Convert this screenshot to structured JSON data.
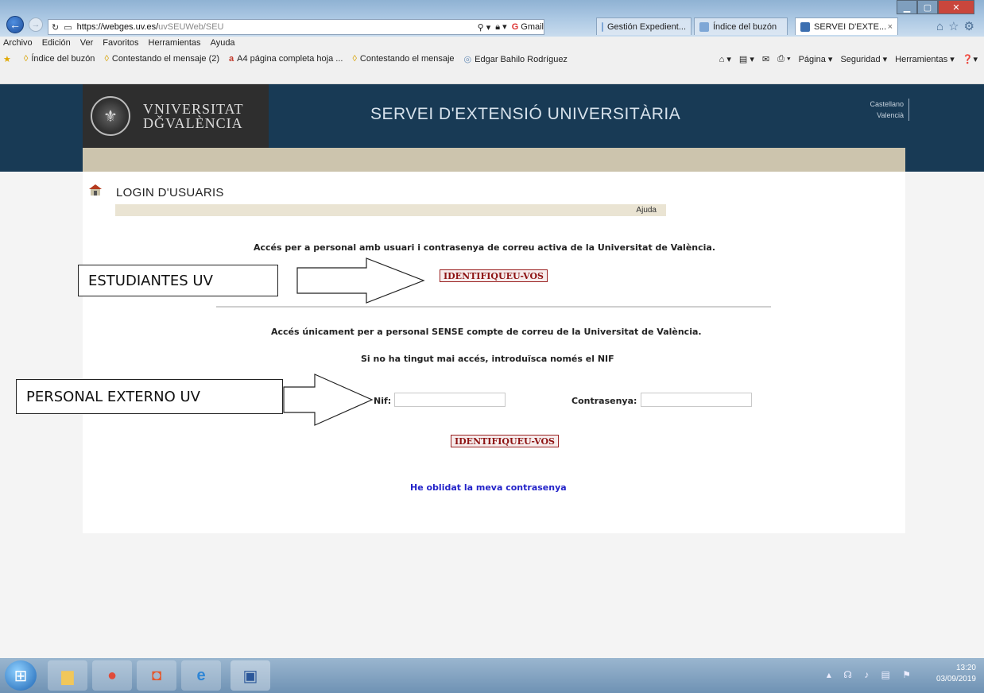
{
  "browser": {
    "url_host": "https://webges.uv.es/",
    "url_path": "uvSEUWeb/SEU",
    "search_tab": "Gmail",
    "tabs": [
      "Gestión Expedient...",
      "Índice del buzón",
      "SERVEI D'EXTE..."
    ],
    "active_tab_close": "×",
    "menu": [
      "Archivo",
      "Edición",
      "Ver",
      "Favoritos",
      "Herramientas",
      "Ayuda"
    ],
    "favorites": [
      "Índice del buzón",
      "Contestando el mensaje (2)",
      "A4 página completa hoja ...",
      "Contestando el mensaje",
      "Edgar Bahilo Rodríguez"
    ],
    "commands": [
      "Página ▾",
      "Seguridad ▾",
      "Herramientas ▾"
    ]
  },
  "site": {
    "logo_line1": "VNIVERSITAT",
    "logo_line2": "DǦVALÈNCIA",
    "title": "SERVEI D'EXTENSIÓ UNIVERSITÀRIA",
    "languages": [
      "Castellano",
      "Valencià"
    ]
  },
  "login": {
    "heading": "LOGIN D'USUARIS",
    "help": "Ajuda",
    "intro_staff": "Accés per a personal amb usuari i contrasenya de correu activa de la Universitat de València.",
    "identify_label": "IDENTIFIQUEU-VOS",
    "intro_external": "Accés únicament per a personal SENSE compte de correu de la Universitat de València.",
    "first_access_note": "Si no ha tingut mai accés, introduïsca només el NIF",
    "nif_label": "Nif:",
    "nif_value": "",
    "password_label": "Contrasenya:",
    "password_value": "",
    "forgot": "He oblidat la meva contrasenya"
  },
  "annotations": {
    "students": "ESTUDIANTES UV",
    "external": "PERSONAL EXTERNO UV"
  },
  "taskbar": {
    "time": "13:20",
    "date": "03/09/2019"
  }
}
